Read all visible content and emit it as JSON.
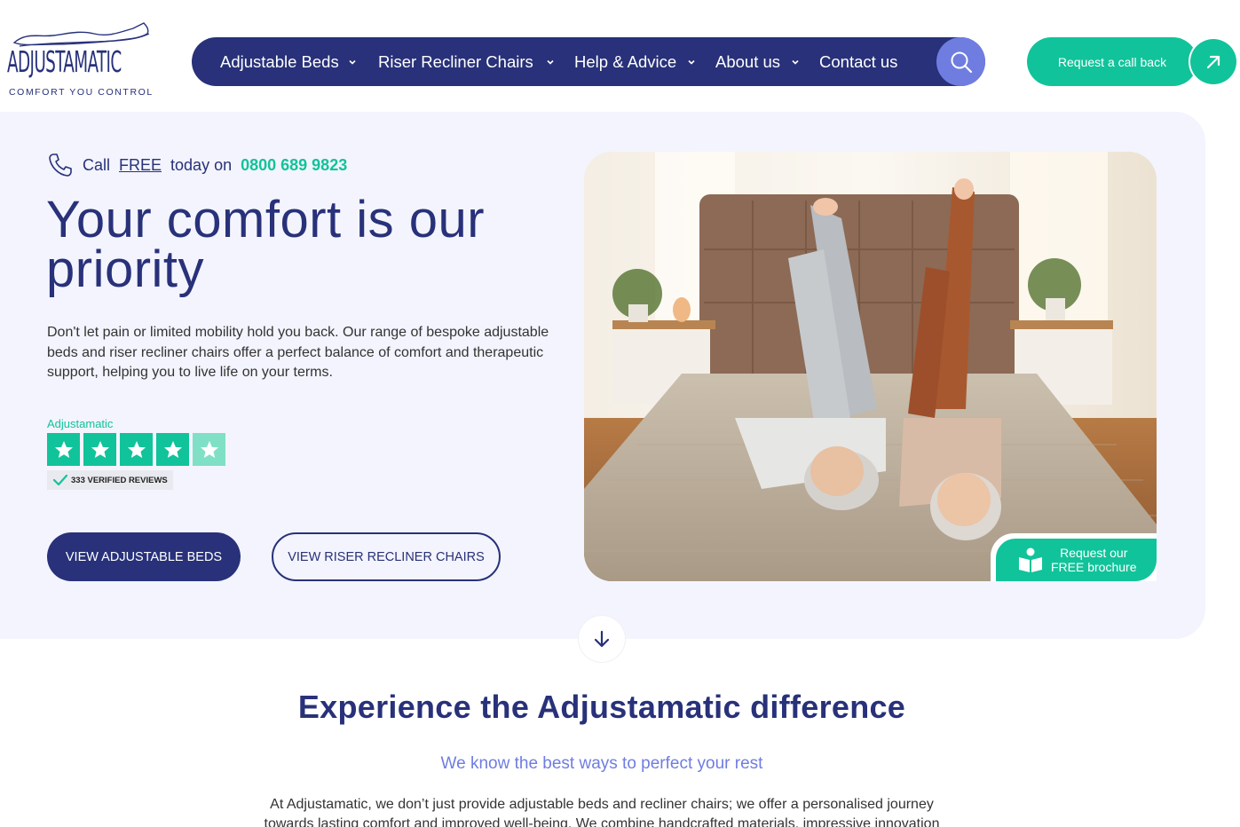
{
  "brand": {
    "name": "ADJUSTAMATIC",
    "tagline": "COMFORT YOU CONTROL"
  },
  "nav": {
    "items": [
      {
        "label": "Adjustable Beds",
        "has_dropdown": true
      },
      {
        "label": "Riser Recliner Chairs",
        "has_dropdown": true
      },
      {
        "label": "Help & Advice",
        "has_dropdown": true
      },
      {
        "label": "About us",
        "has_dropdown": true
      },
      {
        "label": "Contact us",
        "has_dropdown": false
      }
    ],
    "search_icon": "search-icon"
  },
  "cta": {
    "callback_label": "Request a call back",
    "callback_icon": "arrow-up-right-icon"
  },
  "hero": {
    "call_prefix": "Call",
    "call_free": "FREE",
    "call_mid": "today on",
    "phone": "0800 689 9823",
    "title": "Your comfort is our priority",
    "text": "Don't let pain or limited mobility hold you back. Our range of bespoke adjustable beds and riser recliner chairs offer a perfect balance of comfort and therapeutic support, helping you to live life on your terms.",
    "rating": {
      "label": "Adjustamatic",
      "stars": 4.5,
      "verified": "333 VERIFIED REVIEWS"
    },
    "btn_beds": "VIEW ADJUSTABLE BEDS",
    "btn_chairs": "VIEW RISER RECLINER CHAIRS",
    "brochure_line1": "Request our",
    "brochure_line2": "FREE brochure"
  },
  "section": {
    "title": "Experience the Adjustamatic difference",
    "subtitle": "We know the best ways to perfect your rest",
    "body": "At Adjustamatic, we don’t just provide adjustable beds and recliner chairs; we offer a personalised journey towards lasting comfort and improved well-being. We combine handcrafted materials, impressive innovation"
  },
  "colors": {
    "navy": "#283179",
    "teal": "#11c39a",
    "periwinkle": "#6f7de0",
    "hero_bg": "#f3f4fd"
  }
}
